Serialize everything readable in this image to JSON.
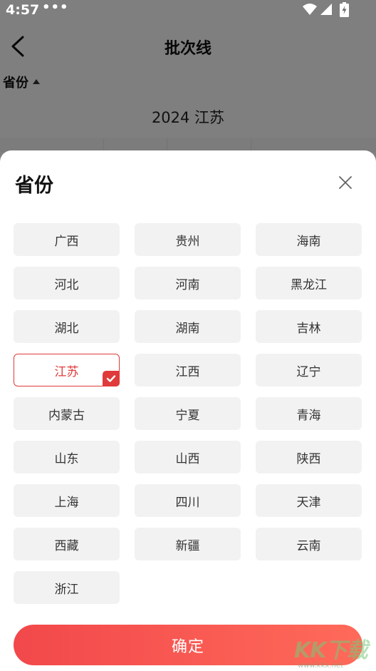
{
  "status_bar": {
    "time": "4:57",
    "dots": "•••"
  },
  "header": {
    "title": "批次线"
  },
  "filter": {
    "label": "省份"
  },
  "content": {
    "heading": "2024 江苏"
  },
  "sheet": {
    "title": "省份",
    "provinces": [
      {
        "label": "广西",
        "selected": false
      },
      {
        "label": "贵州",
        "selected": false
      },
      {
        "label": "海南",
        "selected": false
      },
      {
        "label": "河北",
        "selected": false
      },
      {
        "label": "河南",
        "selected": false
      },
      {
        "label": "黑龙江",
        "selected": false
      },
      {
        "label": "湖北",
        "selected": false
      },
      {
        "label": "湖南",
        "selected": false
      },
      {
        "label": "吉林",
        "selected": false
      },
      {
        "label": "江苏",
        "selected": true
      },
      {
        "label": "江西",
        "selected": false
      },
      {
        "label": "辽宁",
        "selected": false
      },
      {
        "label": "内蒙古",
        "selected": false
      },
      {
        "label": "宁夏",
        "selected": false
      },
      {
        "label": "青海",
        "selected": false
      },
      {
        "label": "山东",
        "selected": false
      },
      {
        "label": "山西",
        "selected": false
      },
      {
        "label": "陕西",
        "selected": false
      },
      {
        "label": "上海",
        "selected": false
      },
      {
        "label": "四川",
        "selected": false
      },
      {
        "label": "天津",
        "selected": false
      },
      {
        "label": "西藏",
        "selected": false
      },
      {
        "label": "新疆",
        "selected": false
      },
      {
        "label": "云南",
        "selected": false
      },
      {
        "label": "浙江",
        "selected": false
      }
    ],
    "confirm_label": "确定"
  },
  "watermark": {
    "logo_text": "KK下载",
    "url": "www.kkx.net"
  },
  "colors": {
    "accent": "#e03a3a",
    "chip_bg": "#f2f2f2"
  }
}
